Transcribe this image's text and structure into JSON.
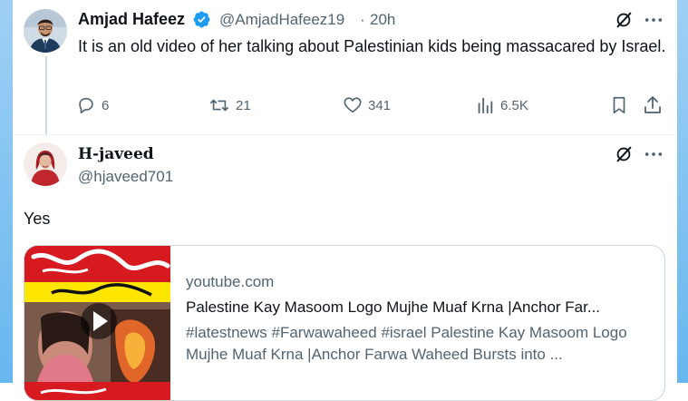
{
  "tweet1": {
    "name": "Amjad Hafeez",
    "handle": "@AmjadHafeez19",
    "separator": "·",
    "time": "20h",
    "text": "It is an old video of her talking about Palestinian kids being massacared by Israel.",
    "actions": {
      "replies": "6",
      "retweets": "21",
      "likes": "341",
      "views": "6.5K"
    }
  },
  "tweet2": {
    "name": "H-javeed",
    "handle": "@hjaveed701",
    "text": "Yes",
    "link_card": {
      "domain": "youtube.com",
      "title": "Palestine Kay Masoom Logo Mujhe Muaf Krna |Anchor Far...",
      "description": "#latestnews #Farwawaheed #israel Palestine Kay Masoom Logo Mujhe Muaf Krna |Anchor Farwa Waheed Bursts into ..."
    }
  },
  "colors": {
    "accent": "#1d9bf0",
    "muted": "#536471",
    "border": "#cfd9de",
    "thumbnail_banner": "#d71920"
  }
}
